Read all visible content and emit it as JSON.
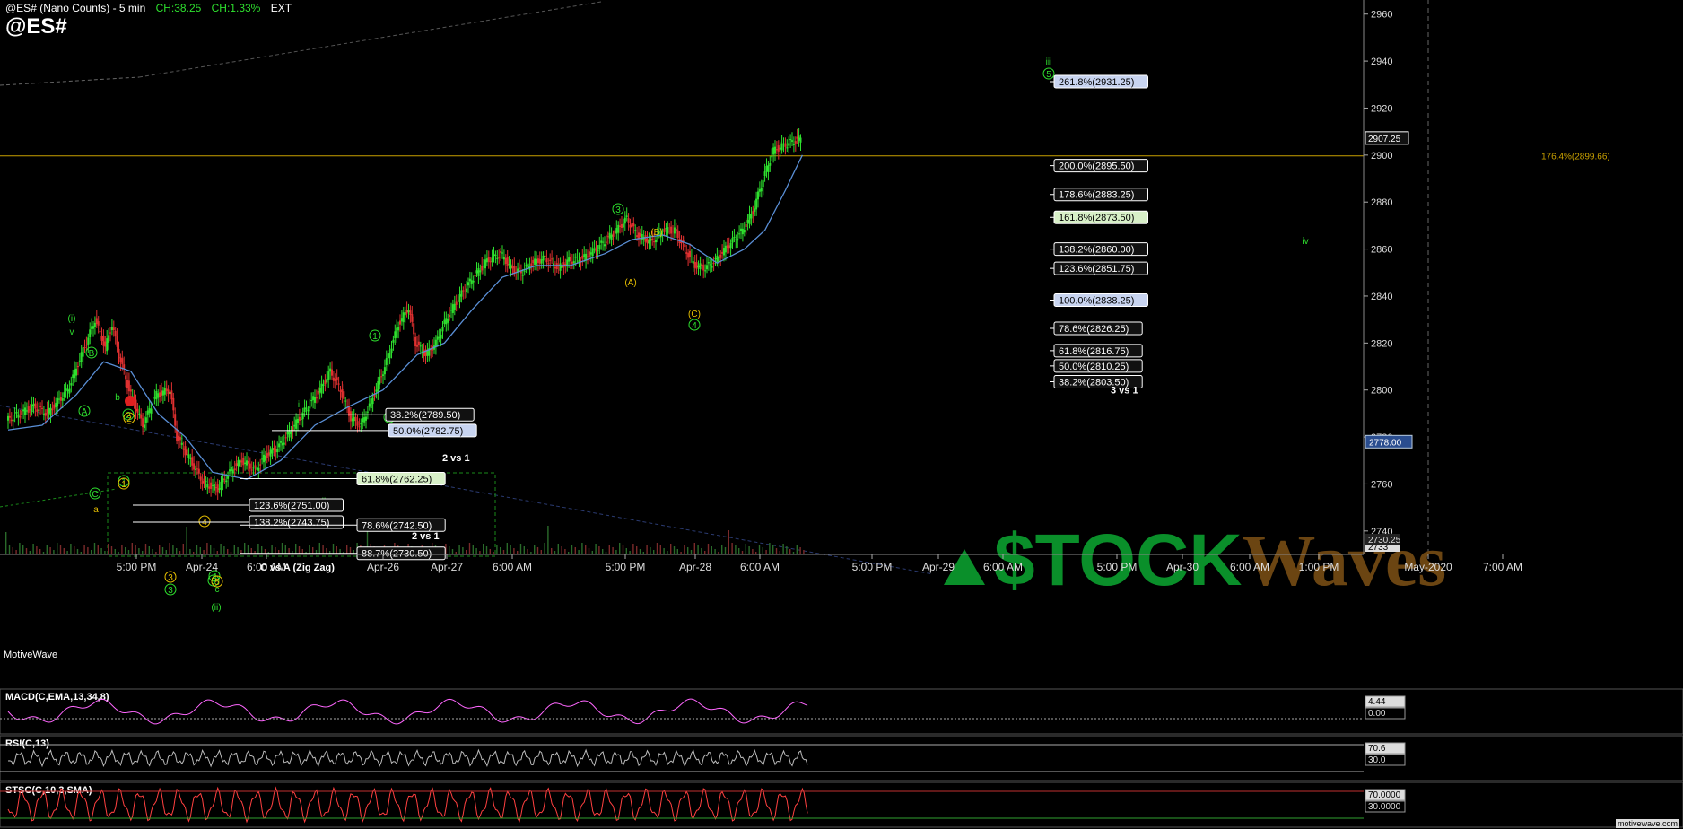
{
  "header": {
    "title": "@ES# (Nano Counts) - 5 min",
    "change_abs": "CH:38.25",
    "change_pct": "CH:1.33%",
    "session": "EXT",
    "symbol": "@ES#"
  },
  "watermark_left": "MotiveWave",
  "site_label": "motivewave.com",
  "logo": {
    "text": "$TOCKWaves",
    "color_stock": "#0a8f2a",
    "color_waves": "#6b4512"
  },
  "colors": {
    "up_candle": "#2ee02e",
    "down_candle": "#e03030",
    "ma": "#5a8fd6",
    "fib_line": "#c8a000",
    "wave_green": "#2ee02e",
    "wave_yellow": "#e8c000"
  },
  "chart_data": {
    "type": "line",
    "title": "@ES# (Nano Counts) - 5 min",
    "y_axis": {
      "ticks": [
        2740,
        2760,
        2780,
        2800,
        2820,
        2840,
        2860,
        2880,
        2900,
        2920,
        2940,
        2960
      ],
      "ylim": [
        2730,
        2966
      ],
      "last_price": "2907.25",
      "ma_value": "2778.00",
      "bottom_labels": [
        "2733",
        "2730.25"
      ],
      "fib_line_label": "176.4%(2899.66)",
      "fib_line_value": 2899.66
    },
    "x_axis": {
      "ticks": [
        "5:00 PM",
        "Apr-24",
        "6:00 AM",
        "Apr-26",
        "Apr-27",
        "6:00 AM",
        "5:00 PM",
        "Apr-28",
        "6:00 AM",
        "5:00 PM",
        "Apr-29",
        "6:00 AM",
        "5:00 PM",
        "Apr-30",
        "6:00 AM",
        "1:00 PM",
        "May-2020",
        "7:00 AM"
      ]
    },
    "price_path": [
      [
        0,
        2787
      ],
      [
        8,
        2790
      ],
      [
        16,
        2793
      ],
      [
        24,
        2790
      ],
      [
        30,
        2795
      ],
      [
        36,
        2800
      ],
      [
        44,
        2815
      ],
      [
        52,
        2830
      ],
      [
        58,
        2818
      ],
      [
        62,
        2828
      ],
      [
        66,
        2815
      ],
      [
        72,
        2800
      ],
      [
        80,
        2785
      ],
      [
        88,
        2798
      ],
      [
        96,
        2800
      ],
      [
        100,
        2780
      ],
      [
        108,
        2770
      ],
      [
        116,
        2760
      ],
      [
        124,
        2758
      ],
      [
        132,
        2766
      ],
      [
        138,
        2770
      ],
      [
        146,
        2766
      ],
      [
        152,
        2772
      ],
      [
        160,
        2776
      ],
      [
        168,
        2784
      ],
      [
        176,
        2792
      ],
      [
        184,
        2800
      ],
      [
        190,
        2808
      ],
      [
        196,
        2800
      ],
      [
        202,
        2788
      ],
      [
        208,
        2785
      ],
      [
        214,
        2795
      ],
      [
        222,
        2810
      ],
      [
        230,
        2828
      ],
      [
        236,
        2835
      ],
      [
        240,
        2820
      ],
      [
        246,
        2815
      ],
      [
        252,
        2820
      ],
      [
        258,
        2830
      ],
      [
        266,
        2840
      ],
      [
        274,
        2848
      ],
      [
        282,
        2855
      ],
      [
        290,
        2858
      ],
      [
        296,
        2852
      ],
      [
        302,
        2850
      ],
      [
        308,
        2854
      ],
      [
        316,
        2856
      ],
      [
        324,
        2852
      ],
      [
        330,
        2855
      ],
      [
        338,
        2856
      ],
      [
        346,
        2860
      ],
      [
        352,
        2864
      ],
      [
        358,
        2868
      ],
      [
        364,
        2873
      ],
      [
        370,
        2866
      ],
      [
        378,
        2863
      ],
      [
        386,
        2868
      ],
      [
        392,
        2868
      ],
      [
        398,
        2860
      ],
      [
        404,
        2853
      ],
      [
        410,
        2852
      ],
      [
        416,
        2855
      ],
      [
        424,
        2862
      ],
      [
        432,
        2868
      ],
      [
        438,
        2876
      ],
      [
        444,
        2890
      ],
      [
        450,
        2902
      ],
      [
        456,
        2904
      ],
      [
        462,
        2906
      ],
      [
        466,
        2907
      ]
    ],
    "ma_path": [
      [
        0,
        2783
      ],
      [
        20,
        2785
      ],
      [
        40,
        2798
      ],
      [
        56,
        2812
      ],
      [
        72,
        2808
      ],
      [
        88,
        2790
      ],
      [
        104,
        2780
      ],
      [
        120,
        2765
      ],
      [
        140,
        2762
      ],
      [
        160,
        2770
      ],
      [
        180,
        2785
      ],
      [
        200,
        2793
      ],
      [
        220,
        2800
      ],
      [
        240,
        2815
      ],
      [
        256,
        2820
      ],
      [
        272,
        2834
      ],
      [
        290,
        2848
      ],
      [
        310,
        2853
      ],
      [
        330,
        2853
      ],
      [
        350,
        2858
      ],
      [
        366,
        2864
      ],
      [
        384,
        2866
      ],
      [
        400,
        2862
      ],
      [
        416,
        2854
      ],
      [
        432,
        2860
      ],
      [
        444,
        2868
      ],
      [
        456,
        2885
      ],
      [
        466,
        2900
      ]
    ],
    "wave_labels_green": [
      "(i)",
      "v",
      "B",
      "A",
      "C",
      "b",
      "2",
      "1",
      "3",
      "4",
      "5",
      "(ii)",
      "c",
      "i",
      "ii",
      "1",
      "2",
      "3",
      "4",
      "iii",
      "5",
      "iv"
    ],
    "wave_labels_yellow": [
      "a",
      "(B)",
      "(A)",
      "(C)",
      "2",
      "1",
      "3",
      "4",
      "5"
    ],
    "fib_boxes": [
      {
        "label": "261.8%(2931.25)",
        "value": 2931.25,
        "style": "blue"
      },
      {
        "label": "200.0%(2895.50)",
        "value": 2895.5,
        "style": "dark"
      },
      {
        "label": "178.6%(2883.25)",
        "value": 2883.25,
        "style": "dark"
      },
      {
        "label": "161.8%(2873.50)",
        "value": 2873.5,
        "style": "green"
      },
      {
        "label": "138.2%(2860.00)",
        "value": 2860.0,
        "style": "dark"
      },
      {
        "label": "123.6%(2851.75)",
        "value": 2851.75,
        "style": "dark"
      },
      {
        "label": "100.0%(2838.25)",
        "value": 2838.25,
        "style": "blue"
      },
      {
        "label": "78.6%(2826.25)",
        "value": 2826.25,
        "style": "dark"
      },
      {
        "label": "61.8%(2816.75)",
        "value": 2816.75,
        "style": "dark"
      },
      {
        "label": "50.0%(2810.25)",
        "value": 2810.25,
        "style": "dark"
      },
      {
        "label": "38.2%(2803.50)",
        "value": 2803.5,
        "style": "dark"
      }
    ],
    "fib_caption_right": "3 vs 1",
    "fib_left_boxes": [
      {
        "label": "38.2%(2789.50)",
        "value": 2789.5,
        "style": "dark"
      },
      {
        "label": "50.0%(2782.75)",
        "value": 2782.75,
        "style": "blue"
      },
      {
        "label": "61.8%(2762.25)",
        "value": 2762.25,
        "style": "green"
      },
      {
        "label": "123.6%(2751.00)",
        "value": 2751.0,
        "style": "dark"
      },
      {
        "label": "138.2%(2743.75)",
        "value": 2743.75,
        "style": "dark"
      },
      {
        "label": "78.6%(2742.50)",
        "value": 2742.5,
        "style": "dark"
      },
      {
        "label": "88.7%(2730.50)",
        "value": 2730.5,
        "style": "dark"
      }
    ],
    "fib_left_captions": [
      "2 vs 1",
      "2 vs 1",
      "C vs A (Zig Zag)"
    ],
    "indicators": [
      {
        "name": "MACD(C,EMA,13,34,8)",
        "values": [
          "4.44",
          "0.00"
        ]
      },
      {
        "name": "RSI(C,13)",
        "values": [
          "70.6",
          "30.0"
        ]
      },
      {
        "name": "STSC(C,10,3,SMA)",
        "values": [
          "70.0000",
          "30.0000"
        ]
      }
    ]
  }
}
